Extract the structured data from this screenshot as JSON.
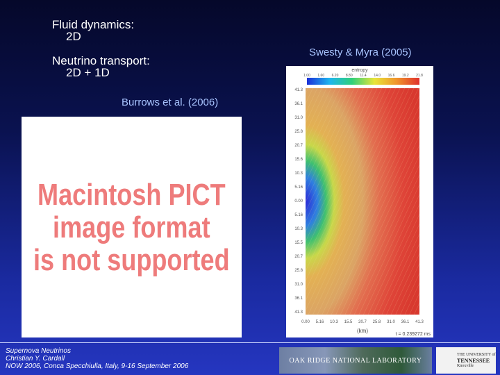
{
  "slide": {
    "fluid_title": "Fluid dynamics:",
    "fluid_value": "2D",
    "transport_title": "Neutrino transport:",
    "transport_value": "2D + 1D",
    "left_citation": "Burrows et al. (2006)",
    "right_citation": "Swesty & Myra (2005)"
  },
  "pict_placeholder": {
    "line1": "Macintosh PICT",
    "line2": "image format",
    "line3": "is not supported"
  },
  "simulation": {
    "colorbar_title": "entropy",
    "colorbar_ticks": [
      "1.00",
      "1.60",
      "6.20",
      "8.80",
      "11.4",
      "14.0",
      "16.6",
      "19.2",
      "21.8"
    ],
    "y_ticks": [
      "41.3",
      "36.1",
      "31.0",
      "25.8",
      "20.7",
      "15.6",
      "10.3",
      "5.16",
      "0.00",
      "5.16",
      "10.3",
      "15.5",
      "20.7",
      "25.8",
      "31.0",
      "36.1",
      "41.3"
    ],
    "x_ticks": [
      "0.00",
      "5.16",
      "10.3",
      "15.5",
      "20.7",
      "25.8",
      "31.0",
      "36.1",
      "41.3"
    ],
    "x_label": "(km)",
    "time_label": "t = 0.239272 ms"
  },
  "footer": {
    "line1": "Supernova Neutrinos",
    "line2": "Christian Y. Cardall",
    "line3": "NOW 2006, Conca Specchiulla, Italy, 9-16 September 2006",
    "lab_banner": "OAK RIDGE NATIONAL LABORATORY",
    "university_line1": "THE UNIVERSITY of",
    "university_line2": "TENNESSEE",
    "university_line3": "Knoxville"
  },
  "colors": {
    "background_top": "#05082a",
    "background_bottom": "#2536c0",
    "citation_blue": "#a8c4ff",
    "pict_red": "#ee7b7b"
  }
}
